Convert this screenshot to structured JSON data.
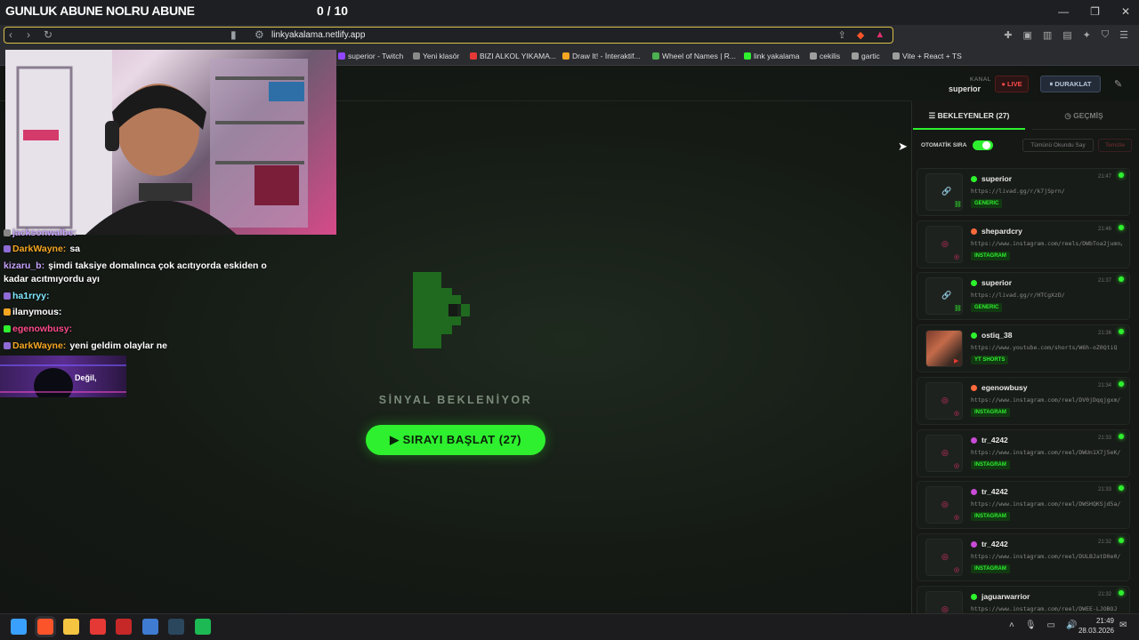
{
  "stream_overlay": {
    "title": "GUNLUK ABUNE NOLRU ABUNE",
    "counter": "0 / 10"
  },
  "browser": {
    "url": "linkyakalama.netlify.app",
    "bookmarks": [
      {
        "label": "superior - Twitch",
        "color": "#9146ff"
      },
      {
        "label": "Yeni klasör",
        "color": "#8a8a8a"
      },
      {
        "label": "BIZI ALKOL YIKAMA...",
        "color": "#e53935"
      },
      {
        "label": "Draw It! - İnteraktif...",
        "color": "#f5a623"
      },
      {
        "label": "Wheel of Names | R...",
        "color": "#4caf50"
      },
      {
        "label": "link yakalama",
        "color": "#2ef02e"
      },
      {
        "label": "cekilis",
        "color": "#9e9e9e"
      },
      {
        "label": "gartic",
        "color": "#9e9e9e"
      },
      {
        "label": "Vite + React + TS",
        "color": "#9e9e9e"
      }
    ]
  },
  "header": {
    "kanal_label": "KANAL",
    "kanal_value": "superior",
    "live_label": "● LIVE",
    "pause_label": "⏸ DURAKLAT"
  },
  "center": {
    "signal_text": "SİNYAL BEKLENİYOR",
    "start_label": "▶  SIRAYI BAŞLAT (27)"
  },
  "chat": [
    {
      "user": "jacksonwalbe:",
      "message": "",
      "nick_class": "nick-purple",
      "badge": "#888"
    },
    {
      "user": "DarkWayne:",
      "message": "sa",
      "nick_class": "nick-orange",
      "badge": "#8f6bd6"
    },
    {
      "user": "kizaru_b:",
      "message": "şimdi taksiye domalınca çok acıtıyorda eskiden o",
      "nick_class": "nick-purple",
      "badge": ""
    },
    {
      "user": "",
      "message": "kadar acıtmıyordu ayı",
      "nick_class": "",
      "badge": ""
    },
    {
      "user": "ha1rryy:",
      "message": "",
      "nick_class": "nick-cyan",
      "badge": "#8f6bd6"
    },
    {
      "user": "ilanymous:",
      "message": "",
      "nick_class": "",
      "badge": "#f5a623"
    },
    {
      "user": "egenowbusy:",
      "message": "",
      "nick_class": "nick-red",
      "badge": "#2ef02e"
    },
    {
      "user": "DarkWayne:",
      "message": "yeni geldim olaylar ne",
      "nick_class": "nick-orange",
      "badge": "#8f6bd6"
    }
  ],
  "clip_text": "Değil,",
  "sidebar": {
    "tab_queue": "☰  BEKLEYENLER (27)",
    "tab_history": "◷  GEÇMİŞ",
    "auto_label": "OTOMATİK SIRA",
    "mark_all": "Tümünü Okundu Say",
    "clear": "Temizle",
    "items": [
      {
        "user": "superior",
        "url": "https://livad.gg/r/k7jSprn/",
        "badge": "GENERIC",
        "time": "21:47",
        "dot": "#2ef02e",
        "icon": "link-icon",
        "thumb": "🔗",
        "thumb_color": "#2ef02e"
      },
      {
        "user": "shepardcry",
        "url": "https://www.instagram.com/reels/DWbToa2jumn/",
        "badge": "INSTAGRAM",
        "time": "21:46",
        "dot": "#ff6a3d",
        "icon": "instagram-icon",
        "thumb": "◎",
        "thumb_color": "#e1306c"
      },
      {
        "user": "superior",
        "url": "https://livad.gg/r/HTCgXzD/",
        "badge": "GENERIC",
        "time": "21:37",
        "dot": "#2ef02e",
        "icon": "link-icon",
        "thumb": "🔗",
        "thumb_color": "#2ef02e"
      },
      {
        "user": "ostiq_38",
        "url": "https://www.youtube.com/shorts/W6h-oZ0QtiQ",
        "badge": "YT SHORTS",
        "time": "21:36",
        "dot": "#2ef02e",
        "icon": "youtube-icon",
        "thumb": "",
        "thumb_color": "#e53935"
      },
      {
        "user": "egenowbusy",
        "url": "https://www.instagram.com/reel/DV0jDqqjgxm/",
        "badge": "INSTAGRAM",
        "time": "21:34",
        "dot": "#ff6a3d",
        "icon": "instagram-icon",
        "thumb": "◎",
        "thumb_color": "#e1306c"
      },
      {
        "user": "tr_4242",
        "url": "https://www.instagram.com/reel/DWUn1X7j5eK/",
        "badge": "INSTAGRAM",
        "time": "21:33",
        "dot": "#c84bd6",
        "icon": "instagram-icon",
        "thumb": "◎",
        "thumb_color": "#e1306c"
      },
      {
        "user": "tr_4242",
        "url": "https://www.instagram.com/reel/DWSHQKSjd5a/",
        "badge": "INSTAGRAM",
        "time": "21:33",
        "dot": "#c84bd6",
        "icon": "instagram-icon",
        "thumb": "◎",
        "thumb_color": "#e1306c"
      },
      {
        "user": "tr_4242",
        "url": "https://www.instagram.com/reel/DULBJatD0e0/",
        "badge": "INSTAGRAM",
        "time": "21:32",
        "dot": "#c84bd6",
        "icon": "instagram-icon",
        "thumb": "◎",
        "thumb_color": "#e1306c"
      },
      {
        "user": "jaguarwarrior",
        "url": "https://www.instagram.com/reel/DWEE-LJOBOJ",
        "badge": "",
        "time": "21:32",
        "dot": "#2ef02e",
        "icon": "instagram-icon",
        "thumb": "◎",
        "thumb_color": "#e1306c"
      }
    ]
  },
  "taskbar": {
    "time": "21:49",
    "date": "28.03.2026",
    "apps": [
      {
        "name": "windows-start-icon",
        "color": "#3aa0ff"
      },
      {
        "name": "brave-browser-icon",
        "color": "#fb542b"
      },
      {
        "name": "file-explorer-icon",
        "color": "#f5c542"
      },
      {
        "name": "app-red-icon",
        "color": "#e53935"
      },
      {
        "name": "app-red-square-icon",
        "color": "#c62828"
      },
      {
        "name": "app-blue-icon",
        "color": "#3f7bd1"
      },
      {
        "name": "steam-icon",
        "color": "#2a475e"
      },
      {
        "name": "spotify-icon",
        "color": "#1db954"
      }
    ]
  }
}
